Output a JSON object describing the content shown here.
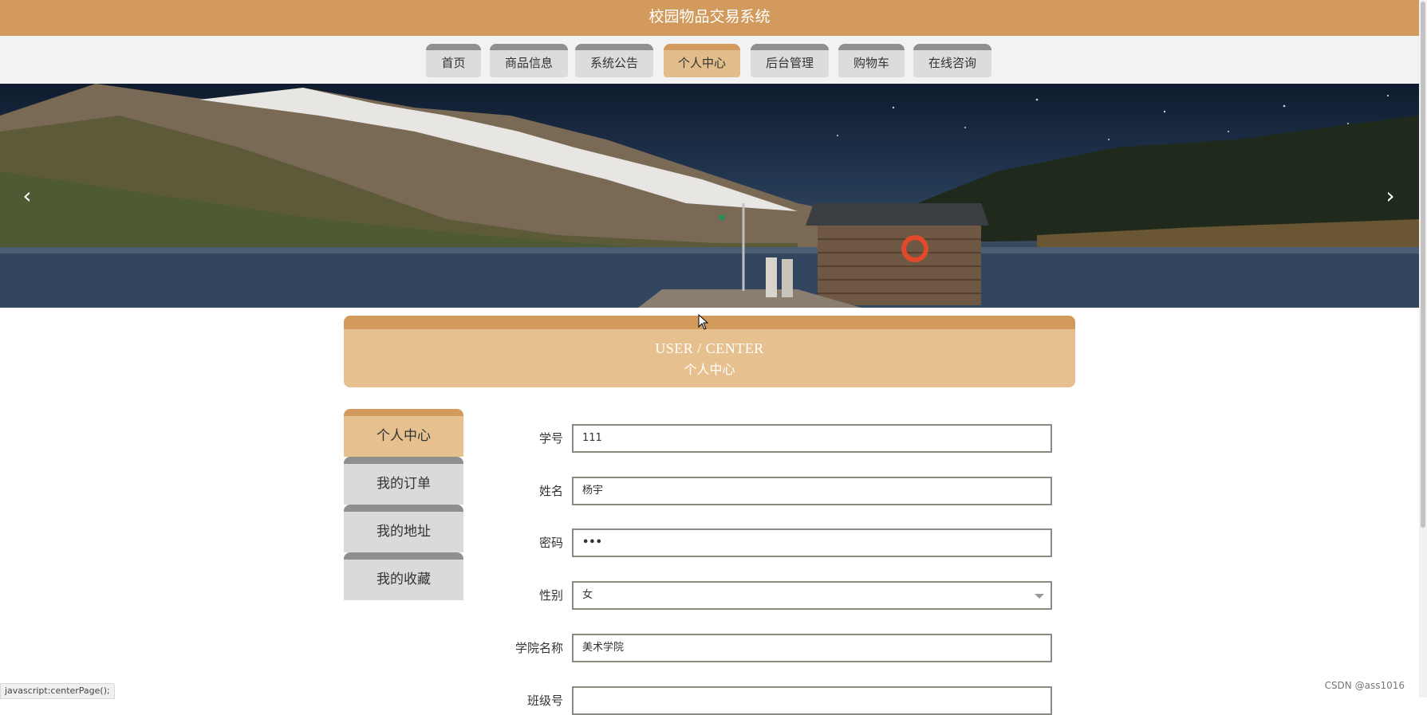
{
  "app": {
    "title": "校园物品交易系统"
  },
  "nav": {
    "items": [
      {
        "label": "首页"
      },
      {
        "label": "商品信息"
      },
      {
        "label": "系统公告"
      },
      {
        "label": "个人中心"
      },
      {
        "label": "后台管理"
      },
      {
        "label": "购物车"
      },
      {
        "label": "在线咨询"
      }
    ],
    "active": "个人中心"
  },
  "banner": {
    "prev_icon": "chevron-left-icon",
    "next_icon": "chevron-right-icon"
  },
  "section": {
    "title_en": "USER / CENTER",
    "title_cn": "个人中心"
  },
  "sidebar": {
    "items": [
      {
        "label": "个人中心"
      },
      {
        "label": "我的订单"
      },
      {
        "label": "我的地址"
      },
      {
        "label": "我的收藏"
      }
    ],
    "active": "个人中心"
  },
  "form": {
    "fields": [
      {
        "label": "学号",
        "value": "111"
      },
      {
        "label": "姓名",
        "value": "杨宇"
      },
      {
        "label": "密码",
        "value": "•••"
      },
      {
        "label": "性别",
        "value": "女"
      },
      {
        "label": "学院名称",
        "value": "美术学院"
      },
      {
        "label": "班级号",
        "value": ""
      }
    ]
  },
  "statusbar": {
    "text": "javascript:centerPage();"
  },
  "watermark": {
    "text": "CSDN @ass1016"
  },
  "colors": {
    "primary": "#d29a5c",
    "active_bg": "#e6c08e",
    "tab_bg": "#dcdcdc"
  }
}
